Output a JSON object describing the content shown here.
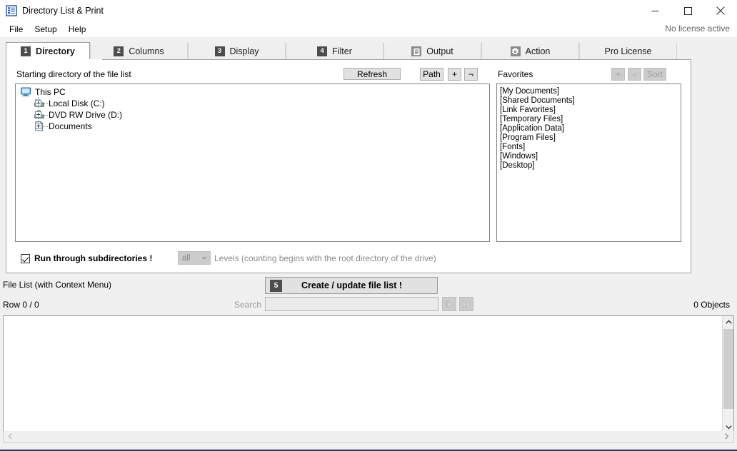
{
  "window": {
    "title": "Directory List & Print",
    "icon": "app-list-icon",
    "minimize": "minimize-icon",
    "maximize": "maximize-icon",
    "close": "close-icon"
  },
  "menu": {
    "items": [
      {
        "label": "File"
      },
      {
        "label": "Setup"
      },
      {
        "label": "Help"
      }
    ],
    "license_note": "No license active"
  },
  "tabs": [
    {
      "badge": "1",
      "label": "Directory",
      "active": true,
      "badge_type": "number"
    },
    {
      "badge": "2",
      "label": "Columns",
      "active": false,
      "badge_type": "number"
    },
    {
      "badge": "3",
      "label": "Display",
      "active": false,
      "badge_type": "number"
    },
    {
      "badge": "4",
      "label": "Filter",
      "active": false,
      "badge_type": "number"
    },
    {
      "badge": "",
      "label": "Output",
      "active": false,
      "badge_type": "document-icon"
    },
    {
      "badge": "",
      "label": "Action",
      "active": false,
      "badge_type": "gear-icon"
    },
    {
      "badge": "",
      "label": "Pro License",
      "active": false,
      "badge_type": "none"
    }
  ],
  "directory_tab": {
    "start_label": "Starting directory of the file list",
    "favorites_label": "Favorites",
    "buttons": {
      "refresh": "Refresh",
      "path": "Path",
      "plus": "+",
      "not": "¬"
    },
    "favorites_buttons": {
      "add": "+",
      "remove": "-",
      "sort": "Sort"
    },
    "tree": [
      {
        "label": "This PC",
        "icon": "monitor-icon",
        "level": 0,
        "expandable": false
      },
      {
        "label": "Local Disk (C:)",
        "icon": "harddisk-icon",
        "level": 1,
        "expandable": true
      },
      {
        "label": "DVD RW Drive (D:)",
        "icon": "optical-drive-icon",
        "level": 1,
        "expandable": true
      },
      {
        "label": "Documents",
        "icon": "documents-icon",
        "level": 1,
        "expandable": true
      }
    ],
    "favorites": [
      "[My Documents]",
      "[Shared Documents]",
      "[Link Favorites]",
      "[Temporary Files]",
      "[Application Data]",
      "[Program Files]",
      "[Fonts]",
      "[Windows]",
      "[Desktop]"
    ],
    "subdirectories": {
      "checkbox_label": "Run through subdirectories !",
      "checked": true,
      "levels_value": "all",
      "levels_label": "Levels",
      "levels_hint": "(counting begins with the root directory of the drive)"
    }
  },
  "filelist": {
    "label": "File List (with Context Menu)",
    "create_badge": "5",
    "create_label": "Create / update file list !",
    "row_count": "Row 0 / 0",
    "search_label": "Search",
    "search_value": "",
    "search_placeholder": "",
    "nav_first": "play-to-start-icon",
    "nav_next": "fast-forward-icon",
    "objects": "0 Objects"
  },
  "colors": {
    "accent": "#1f3864",
    "badge": "#4d4d4d",
    "window_bg": "#f0f0f0",
    "panel_bg": "#ffffff",
    "border": "#a0a0a0",
    "disabled_text": "#9a9a9a"
  }
}
